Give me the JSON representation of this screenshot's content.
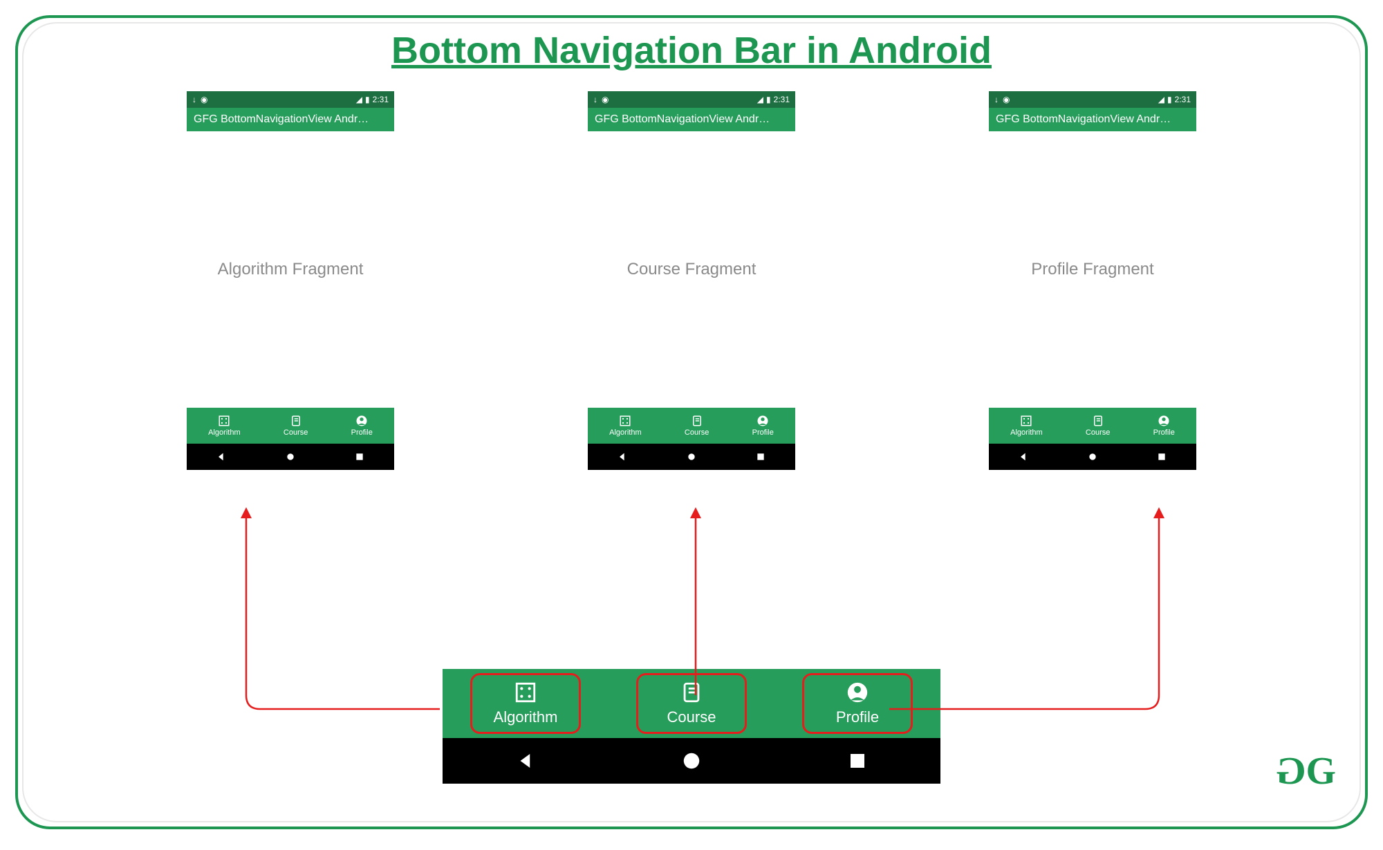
{
  "title": "Bottom Navigation Bar in Android",
  "status_time": "2:31",
  "app_bar_title": "GFG BottomNavigationView Andr…",
  "phones": [
    {
      "fragment_label": "Algorithm Fragment"
    },
    {
      "fragment_label": "Course Fragment"
    },
    {
      "fragment_label": "Profile Fragment"
    }
  ],
  "nav_items": [
    {
      "label": "Algorithm",
      "icon": "grid"
    },
    {
      "label": "Course",
      "icon": "book"
    },
    {
      "label": "Profile",
      "icon": "person"
    }
  ],
  "logo_text": "GG"
}
